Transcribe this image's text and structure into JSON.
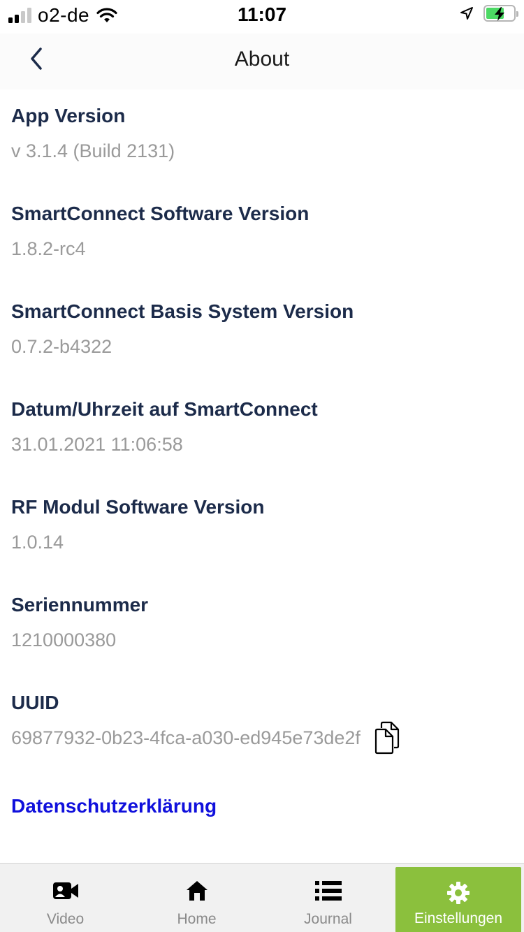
{
  "status_bar": {
    "carrier": "o2-de",
    "time": "11:07"
  },
  "nav": {
    "title": "About",
    "back_icon": "chevron-left-icon"
  },
  "info": [
    {
      "label": "App Version",
      "value": "v 3.1.4 (Build 2131)"
    },
    {
      "label": "SmartConnect Software Version",
      "value": "1.8.2-rc4"
    },
    {
      "label": "SmartConnect Basis System Version",
      "value": "0.7.2-b4322"
    },
    {
      "label": "Datum/Uhrzeit auf SmartConnect",
      "value": "31.01.2021 11:06:58"
    },
    {
      "label": "RF Modul Software Version",
      "value": "1.0.14"
    },
    {
      "label": "Seriennummer",
      "value": "1210000380"
    },
    {
      "label": "UUID",
      "value": "69877932-0b23-4fca-a030-ed945e73de2f"
    }
  ],
  "privacy_link": "Datenschutzerklärung",
  "tabs": [
    {
      "label": "Video",
      "icon": "video-camera-icon"
    },
    {
      "label": "Home",
      "icon": "home-icon"
    },
    {
      "label": "Journal",
      "icon": "list-icon"
    },
    {
      "label": "Einstellungen",
      "icon": "gear-icon",
      "active": true
    }
  ],
  "colors": {
    "label": "#1c2b4a",
    "value": "#9a9a9a",
    "link": "#1010dc",
    "active_tab": "#8bc03d"
  }
}
